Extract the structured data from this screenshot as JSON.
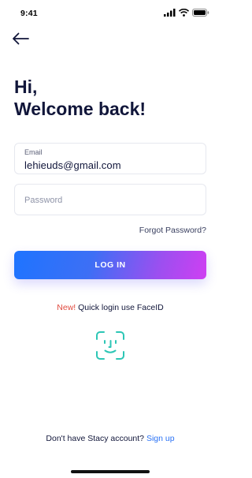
{
  "status_bar": {
    "time": "9:41",
    "icons": [
      "cellular-signal-icon",
      "wifi-icon",
      "battery-icon"
    ]
  },
  "header": {
    "back_icon": "arrow-left-icon"
  },
  "greeting": {
    "line1": "Hi,",
    "line2": "Welcome back!"
  },
  "form": {
    "email_label": "Email",
    "email_value": "lehieuds@gmail.com",
    "password_placeholder": "Password",
    "forgot_label": "Forgot Password?"
  },
  "login_button": {
    "label": "LOG IN",
    "gradient_start": "#1e74ff",
    "gradient_end": "#cf3ff2"
  },
  "faceid": {
    "new_badge": "New!",
    "text": "Quick login use FaceID",
    "icon": "face-id-icon",
    "icon_color": "#2cc6b5"
  },
  "signup": {
    "prompt": "Don't have Stacy account?",
    "link": "Sign up",
    "link_color": "#2a72f5"
  }
}
